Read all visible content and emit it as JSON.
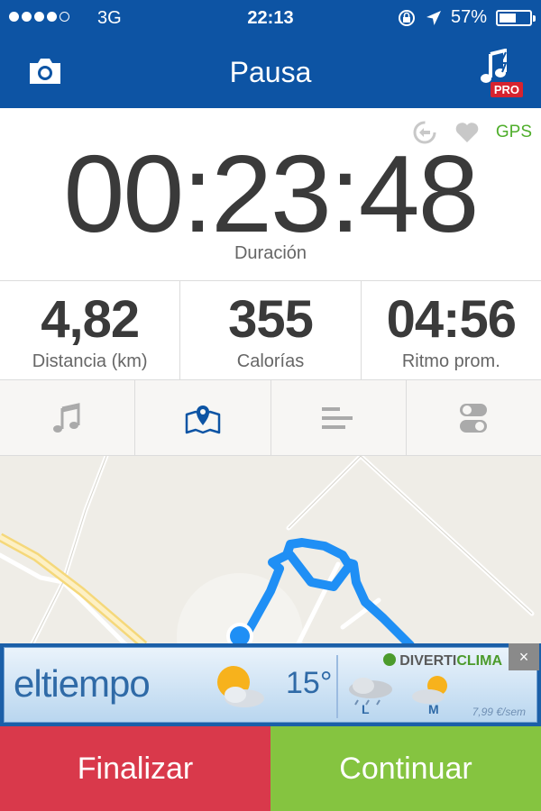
{
  "status_bar": {
    "carrier": "3G",
    "time": "22:13",
    "battery": "57%",
    "battery_level": 0.57,
    "signal_bars_filled": 4,
    "signal_bars_total": 5
  },
  "nav": {
    "title": "Pausa",
    "pro_badge": "PRO",
    "camera_icon": "camera-icon",
    "music_icon": "music-pro-icon"
  },
  "indicators": {
    "gps": "GPS",
    "gps_color": "#4fae2b"
  },
  "timer": {
    "value": "00:23:48",
    "label": "Duración"
  },
  "stats": [
    {
      "value": "4,82",
      "label": "Distancia (km)"
    },
    {
      "value": "355",
      "label": "Calorías"
    },
    {
      "value": "04:56",
      "label": "Ritmo prom."
    }
  ],
  "tabs": [
    {
      "icon": "music-note-icon",
      "active": false
    },
    {
      "icon": "map-pin-icon",
      "active": true
    },
    {
      "icon": "bars-icon",
      "active": false
    },
    {
      "icon": "toggles-icon",
      "active": false
    }
  ],
  "ad": {
    "brand": "eltiempo",
    "temperature": "15°",
    "sponsor_prefix": "DIVERTI",
    "sponsor_suffix": "CLIMA",
    "day_l": "L",
    "day_m": "M",
    "price": "7,99 €/sem"
  },
  "buttons": {
    "finish": "Finalizar",
    "continue": "Continuar"
  },
  "colors": {
    "brand_blue": "#0d54a4",
    "finish_red": "#d9394b",
    "continue_green": "#85c440",
    "route_blue": "#1f8ff5"
  }
}
